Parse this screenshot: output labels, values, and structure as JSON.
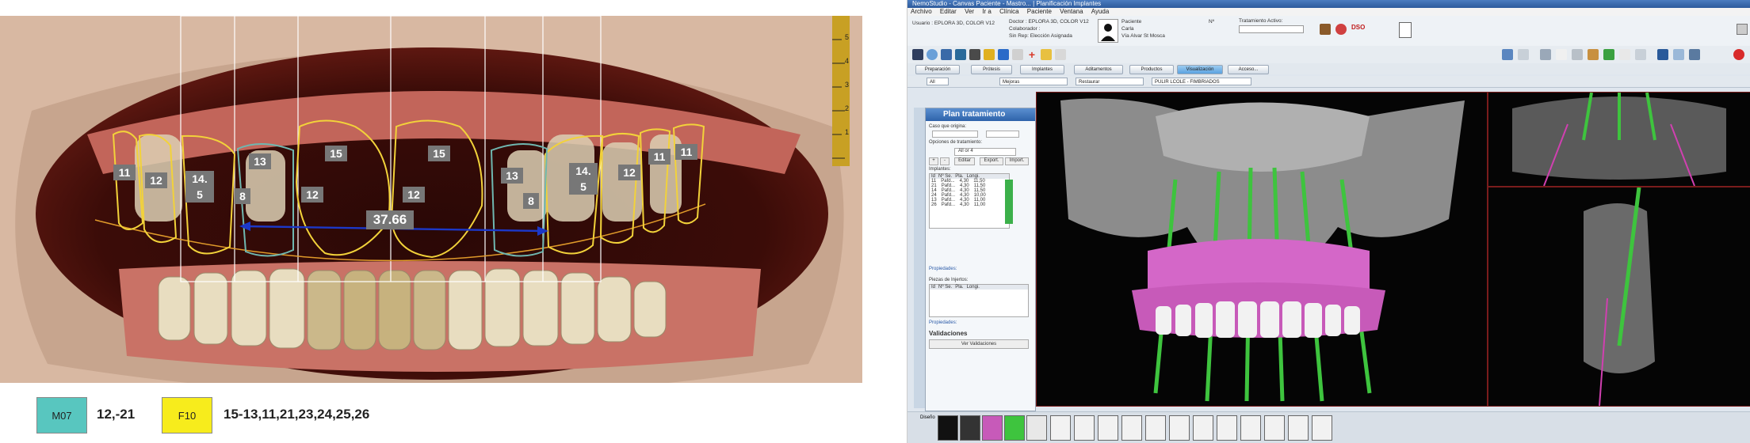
{
  "left": {
    "measurement": "37.66",
    "tooth_labels": [
      "11",
      "12",
      "14.\n5",
      "13",
      "8",
      "15",
      "12",
      "15",
      "12",
      "13",
      "8",
      "14.\n5",
      "12",
      "11",
      "11"
    ],
    "legend": [
      {
        "code": "M07",
        "teeth": "12,-21",
        "color": "#58c6bf"
      },
      {
        "code": "F10",
        "teeth": "15-13,11,21,23,24,25,26",
        "color": "#f7ec1c"
      }
    ],
    "ruler_marks": [
      "5",
      "4",
      "3",
      "2",
      "1"
    ]
  },
  "right": {
    "titlebar": "NemoStudio  -  Canvas Paciente - Mastro... | Planificación Implantes",
    "menu": [
      "Archivo",
      "Editar",
      "Ver",
      "Ir a",
      "Clínica",
      "Paciente",
      "Ventana",
      "Ayuda"
    ],
    "info": {
      "usuario": "Usuario : EPLORA 3D, COLOR V12",
      "doctor": "Doctor : EPLORA 3D, COLOR V12",
      "colaborador": "Colaborador :",
      "grupo": "Sin Rep: Elección Asignada",
      "paciente_label": "Paciente",
      "paciente_name": "Carla",
      "paciente_addr": "Vía Alvar St Mosca",
      "num": "Nº",
      "tratamiento": "Tratamiento Activo:"
    },
    "tabs": [
      "Preparación",
      "Prótesis",
      "Implantes",
      "Aditamentos",
      "Productos",
      "Visualización",
      "Acceso..."
    ],
    "active_tab": "Visualización",
    "filters": [
      "All",
      "Mejoras",
      "Restaurar",
      "PULIR LCOLE - FIMBRIADOS"
    ],
    "plan": {
      "title": "Plan tratamiento",
      "caso": "Caso que origina:",
      "opciones": "Opciones de tratamiento:",
      "all_label": "All or 4",
      "buttons": [
        "+",
        "-",
        "Editar",
        "Export.",
        "Import."
      ],
      "implantes_label": "Implantes:",
      "columns": [
        "Id",
        "Nº Se.",
        "Pla.",
        "Longi."
      ],
      "rows": [
        [
          "11",
          "Pafd...",
          "4,30",
          "11,50"
        ],
        [
          "21",
          "Pafd...",
          "4,30",
          "11,50"
        ],
        [
          "14",
          "Pafd...",
          "4,30",
          "11,50"
        ],
        [
          "24",
          "Pafd...",
          "4,30",
          "10,00"
        ],
        [
          "13",
          "Pafd...",
          "4,30",
          "11,00"
        ],
        [
          "26",
          "Pafd...",
          "4,30",
          "11,00"
        ]
      ],
      "propiedades": "Propiedades:",
      "piezas": "Piezas de Injertos:",
      "propiedades2": "Propiedades:",
      "validaciones": "Validaciones",
      "ver_validaciones": "Ver Validaciones"
    },
    "thumb_label": "Diseño"
  }
}
